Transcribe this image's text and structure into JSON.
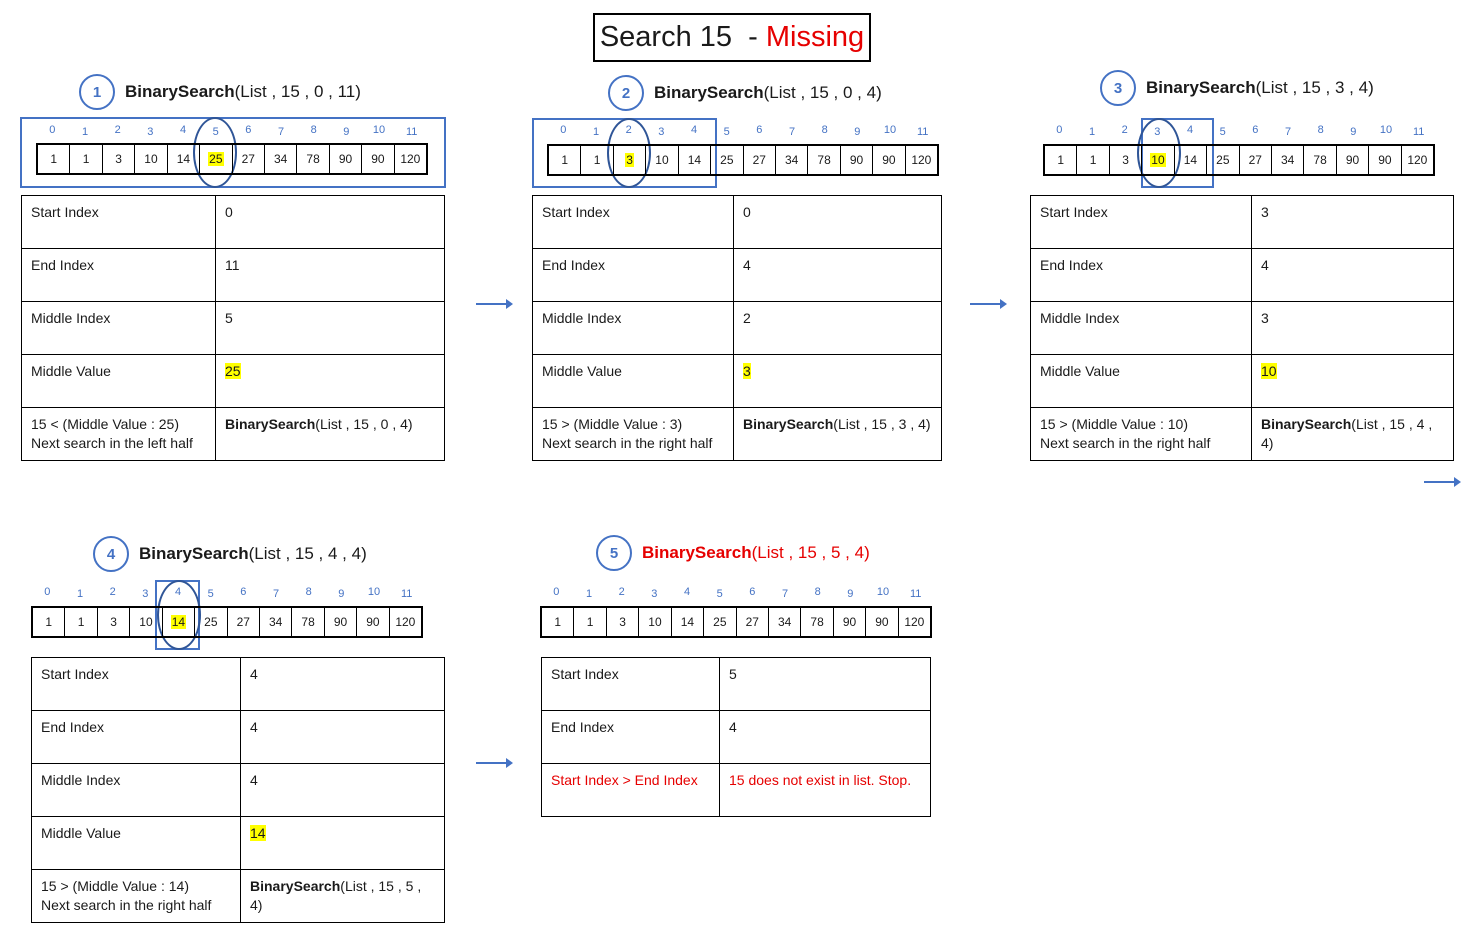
{
  "title": {
    "prefix": "Search 15  - ",
    "status": "Missing"
  },
  "list_values": [
    "1",
    "1",
    "3",
    "10",
    "14",
    "25",
    "27",
    "34",
    "78",
    "90",
    "90",
    "120"
  ],
  "indices": [
    "0",
    "1",
    "2",
    "3",
    "4",
    "5",
    "6",
    "7",
    "8",
    "9",
    "10",
    "11"
  ],
  "colors": {
    "accent": "#4472c4",
    "highlight": "#ffff00",
    "error": "#e60000"
  },
  "labels": {
    "start": "Start Index",
    "end": "End Index",
    "middle_index": "Middle Index",
    "middle_value": "Middle Value",
    "fn": "BinarySearch",
    "list": "List"
  },
  "steps": [
    {
      "num": "1",
      "args": "(List , 15 , 0 , 11)",
      "start": "0",
      "end": "11",
      "mid_index": "5",
      "mid_value": "25",
      "cond_line1": "15 < (Middle Value : 25)",
      "cond_line2": "Next search in the left half",
      "next_fn": "BinarySearch",
      "next_args": "(List , 15 , 0 , 4)",
      "highlight_index": 5
    },
    {
      "num": "2",
      "args": "(List , 15 , 0 , 4)",
      "start": "0",
      "end": "4",
      "mid_index": "2",
      "mid_value": "3",
      "cond_line1": "15 > (Middle Value : 3)",
      "cond_line2": "Next search in the right half",
      "next_fn": "BinarySearch",
      "next_args": "(List , 15 , 3 , 4)",
      "highlight_index": 2
    },
    {
      "num": "3",
      "args": "(List , 15 , 3 , 4)",
      "start": "3",
      "end": "4",
      "mid_index": "3",
      "mid_value": "10",
      "cond_line1": "15 > (Middle Value : 10)",
      "cond_line2": "Next search in the right half",
      "next_fn": "BinarySearch",
      "next_args": "(List , 15 , 4 ,",
      "next_args2": "4)",
      "highlight_index": 3
    },
    {
      "num": "4",
      "args": "(List , 15 , 4 , 4)",
      "start": "4",
      "end": "4",
      "mid_index": "4",
      "mid_value": "14",
      "cond_line1": "15 > (Middle Value : 14)",
      "cond_line2": "Next search in the right half",
      "next_fn": "BinarySearch",
      "next_args": "(List , 15 , 5 , 4)",
      "highlight_index": 4
    },
    {
      "num": "5",
      "args": "(List , 15 , 5 , 4)",
      "start": "5",
      "end": "4",
      "stop_condition": "Start Index > End Index",
      "stop_message": "15 does not exist in list. Stop.",
      "highlight_index": -1
    }
  ]
}
